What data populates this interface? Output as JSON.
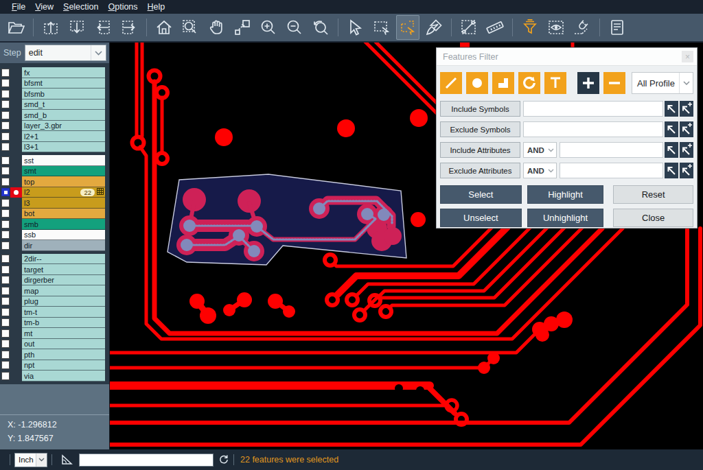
{
  "menu": {
    "items": [
      {
        "label": "File",
        "underline": "F"
      },
      {
        "label": "View",
        "underline": "V"
      },
      {
        "label": "Selection",
        "underline": "S"
      },
      {
        "label": "Options",
        "underline": "O"
      },
      {
        "label": "Help",
        "underline": "H"
      }
    ]
  },
  "toolbar": {
    "items": [
      {
        "icon": "open-folder-icon"
      },
      {
        "sep": true
      },
      {
        "icon": "paste-up-icon"
      },
      {
        "icon": "paste-down-icon"
      },
      {
        "icon": "paste-left-icon"
      },
      {
        "icon": "paste-right-icon"
      },
      {
        "sep": true
      },
      {
        "icon": "home-icon"
      },
      {
        "icon": "zoom-window-icon"
      },
      {
        "icon": "pan-hand-icon"
      },
      {
        "icon": "zoom-object-icon"
      },
      {
        "icon": "zoom-in-icon"
      },
      {
        "icon": "zoom-out-icon"
      },
      {
        "icon": "zoom-previous-icon"
      },
      {
        "sep": true
      },
      {
        "icon": "select-arrow-icon"
      },
      {
        "icon": "select-rectangle-icon"
      },
      {
        "icon": "select-polygon-icon",
        "active": true,
        "accent": true
      },
      {
        "icon": "brush-icon"
      },
      {
        "sep": true
      },
      {
        "icon": "measure-distance-icon"
      },
      {
        "icon": "ruler-icon"
      },
      {
        "sep": true
      },
      {
        "icon": "filter-icon",
        "accent": true
      },
      {
        "icon": "view-eye-icon"
      },
      {
        "icon": "snap-magnet-icon"
      },
      {
        "sep": true
      },
      {
        "icon": "report-icon"
      }
    ]
  },
  "sidebar": {
    "step_label": "Step",
    "step_value": "edit",
    "groups": [
      {
        "rows": [
          {
            "name": "fx",
            "color": "teal"
          },
          {
            "name": "bfsmt",
            "color": "teal"
          },
          {
            "name": "bfsmb",
            "color": "teal"
          },
          {
            "name": "smd_t",
            "color": "teal"
          },
          {
            "name": "smd_b",
            "color": "teal"
          },
          {
            "name": "layer_3.gbr",
            "color": "teal"
          },
          {
            "name": "l2+1",
            "color": "teal"
          },
          {
            "name": "l3+1",
            "color": "teal"
          }
        ]
      },
      {
        "rows": [
          {
            "name": "sst",
            "color": "white"
          },
          {
            "name": "smt",
            "color": "green"
          },
          {
            "name": "top",
            "color": "orange"
          },
          {
            "name": "l2",
            "color": "gold",
            "active": true,
            "checked": true,
            "count": "22",
            "grid_icon": true
          },
          {
            "name": "l3",
            "color": "gold"
          },
          {
            "name": "bot",
            "color": "orange"
          },
          {
            "name": "smb",
            "color": "green"
          },
          {
            "name": "ssb",
            "color": "white"
          },
          {
            "name": "dir",
            "color": "gray"
          }
        ]
      },
      {
        "rows": [
          {
            "name": "2dir--",
            "color": "teal"
          },
          {
            "name": "target",
            "color": "teal"
          },
          {
            "name": "dirgerber",
            "color": "teal"
          },
          {
            "name": "map",
            "color": "teal"
          },
          {
            "name": "plug",
            "color": "teal"
          },
          {
            "name": "tm-t",
            "color": "teal"
          },
          {
            "name": "tm-b",
            "color": "teal"
          },
          {
            "name": "mt",
            "color": "teal"
          },
          {
            "name": "out",
            "color": "teal"
          },
          {
            "name": "pth",
            "color": "teal"
          },
          {
            "name": "npt",
            "color": "teal"
          },
          {
            "name": "via",
            "color": "teal"
          }
        ]
      }
    ],
    "coords": {
      "x": "X: -1.296812",
      "y": "Y: 1.847567"
    }
  },
  "dialog": {
    "title": "Features Filter",
    "close_icon": "x",
    "type_buttons": [
      {
        "icon": "line-icon",
        "style": "orange"
      },
      {
        "icon": "pad-icon",
        "style": "orange"
      },
      {
        "icon": "surface-icon",
        "style": "orange"
      },
      {
        "icon": "arc-icon",
        "style": "orange"
      },
      {
        "icon": "text-icon",
        "style": "orange"
      },
      {
        "icon": "plus-icon",
        "style": "dark",
        "gap": true
      },
      {
        "icon": "minus-icon",
        "style": "orange"
      }
    ],
    "profile_value": "All Profile",
    "filter_rows": [
      {
        "label": "Include Symbols",
        "has_and": false,
        "value": ""
      },
      {
        "label": "Exclude Symbols",
        "has_and": false,
        "value": ""
      },
      {
        "label": "Include Attributes",
        "has_and": true,
        "and_value": "AND",
        "value": ""
      },
      {
        "label": "Exclude Attributes",
        "has_and": true,
        "and_value": "AND",
        "value": ""
      }
    ],
    "action_rows": [
      [
        {
          "label": "Select",
          "style": "dark"
        },
        {
          "label": "Highlight",
          "style": "dark"
        },
        {
          "label": "Reset",
          "style": "light"
        }
      ],
      [
        {
          "label": "Unselect",
          "style": "dark"
        },
        {
          "label": "Unhighlight",
          "style": "dark"
        },
        {
          "label": "Close",
          "style": "light"
        }
      ]
    ]
  },
  "statusbar": {
    "unit_value": "Inch",
    "input_value": "",
    "message": "22 features were selected"
  },
  "canvas": {
    "colors": {
      "background": "#000000",
      "trace_red": "#fe0000",
      "selected_crimson": "#ce2157",
      "selected_pad_blue": "#8289bb",
      "selection_fill": "#161a49",
      "selection_outline": "#c9cce0",
      "accent_orange": "#f2a21c"
    }
  }
}
